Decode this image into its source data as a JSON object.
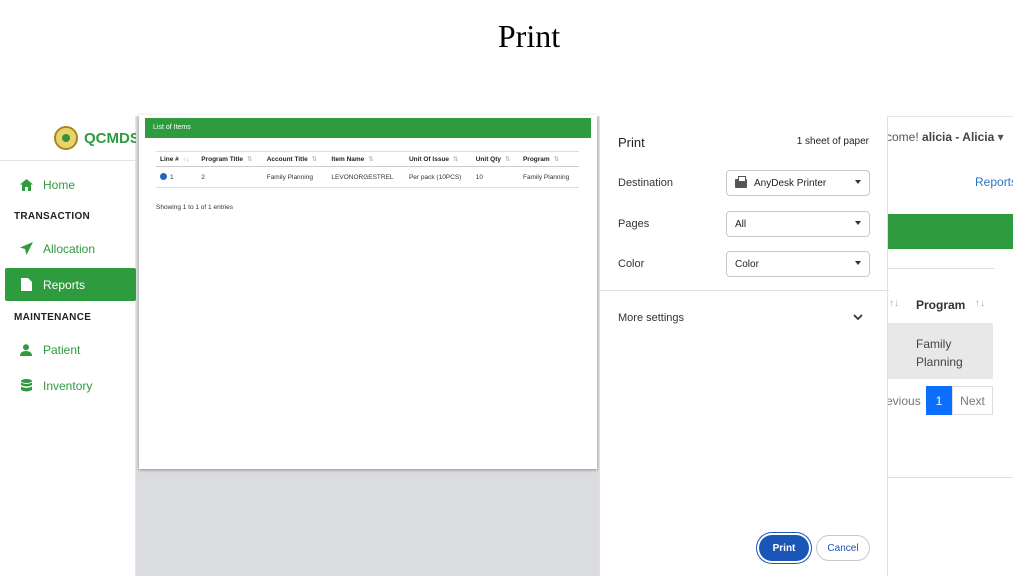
{
  "slide": {
    "title": "Print"
  },
  "app": {
    "brand": "QCMDS",
    "welcome_prefix": "come!",
    "welcome_user": "alicia - Alicia",
    "nav": {
      "home": "Home",
      "transaction_heading": "TRANSACTION",
      "allocation": "Allocation",
      "reports": "Reports",
      "maintenance_heading": "MAINTENANCE",
      "patient": "Patient",
      "inventory": "Inventory"
    },
    "reports_link": "Reports",
    "table_header_program": "Program",
    "table_cell": "Family Planning",
    "pager": {
      "prev": "evious",
      "page": "1",
      "next": "Next"
    }
  },
  "preview": {
    "header": "List of Items",
    "columns": [
      "Line #",
      "Program Title",
      "Account Title",
      "Item Name",
      "Unit Of Issue",
      "Unit Qty",
      "Program"
    ],
    "rows": [
      [
        "1",
        "2",
        "Family Planning",
        "LEVONORGESTREL",
        "Per pack (10PCS)",
        "10",
        "Family Planning"
      ]
    ],
    "showing": "Showing 1 to 1 of 1 entries"
  },
  "print_dialog": {
    "title": "Print",
    "sheets": "1 sheet of paper",
    "destination_label": "Destination",
    "destination_value": "AnyDesk Printer",
    "pages_label": "Pages",
    "pages_value": "All",
    "color_label": "Color",
    "color_value": "Color",
    "more_settings": "More settings",
    "print_button": "Print",
    "cancel_button": "Cancel"
  },
  "colors": {
    "brand_green": "#2e9b3f",
    "primary_blue": "#1a56b8",
    "link_blue": "#2a74c8"
  }
}
